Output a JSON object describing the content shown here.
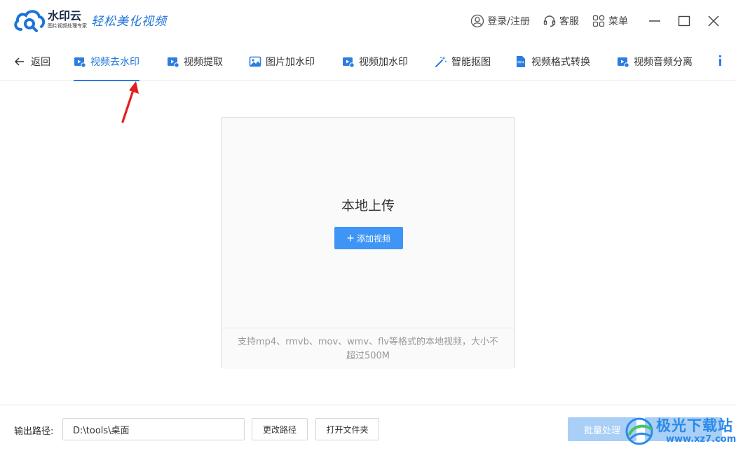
{
  "app": {
    "name": "水印云",
    "subtitle": "图片视频处理专家",
    "slogan": "轻松美化视频"
  },
  "titlebar": {
    "login_label": "登录/注册",
    "service_label": "客服",
    "menu_label": "菜单"
  },
  "nav": {
    "back_label": "返回",
    "tabs": [
      {
        "label": "视频去水印",
        "icon": "video-icon",
        "active": true
      },
      {
        "label": "视频提取",
        "icon": "video-icon",
        "active": false
      },
      {
        "label": "图片加水印",
        "icon": "image-icon",
        "active": false
      },
      {
        "label": "视频加水印",
        "icon": "video-icon",
        "active": false
      },
      {
        "label": "智能抠图",
        "icon": "magic-wand-icon",
        "active": false
      },
      {
        "label": "视频格式转换",
        "icon": "mp4-file-icon",
        "active": false
      },
      {
        "label": "视频音频分离",
        "icon": "video-icon",
        "active": false
      }
    ]
  },
  "upload": {
    "title": "本地上传",
    "add_button": "添加视频",
    "hint": "支持mp4、rmvb、mov、wmv、flv等格式的本地视频，大小不超过500M"
  },
  "bottom": {
    "output_label": "输出路径:",
    "output_path": "D:\\tools\\桌面",
    "change_path": "更改路径",
    "open_folder": "打开文件夹",
    "batch_process": "批量处理"
  },
  "watermark": {
    "text": "极光下载站",
    "url": "www.xz7.com"
  },
  "colors": {
    "accent": "#1d73d9",
    "button_blue": "#3f95f5",
    "disabled_blue": "#a9cff7",
    "annotation_red": "#e02020"
  }
}
